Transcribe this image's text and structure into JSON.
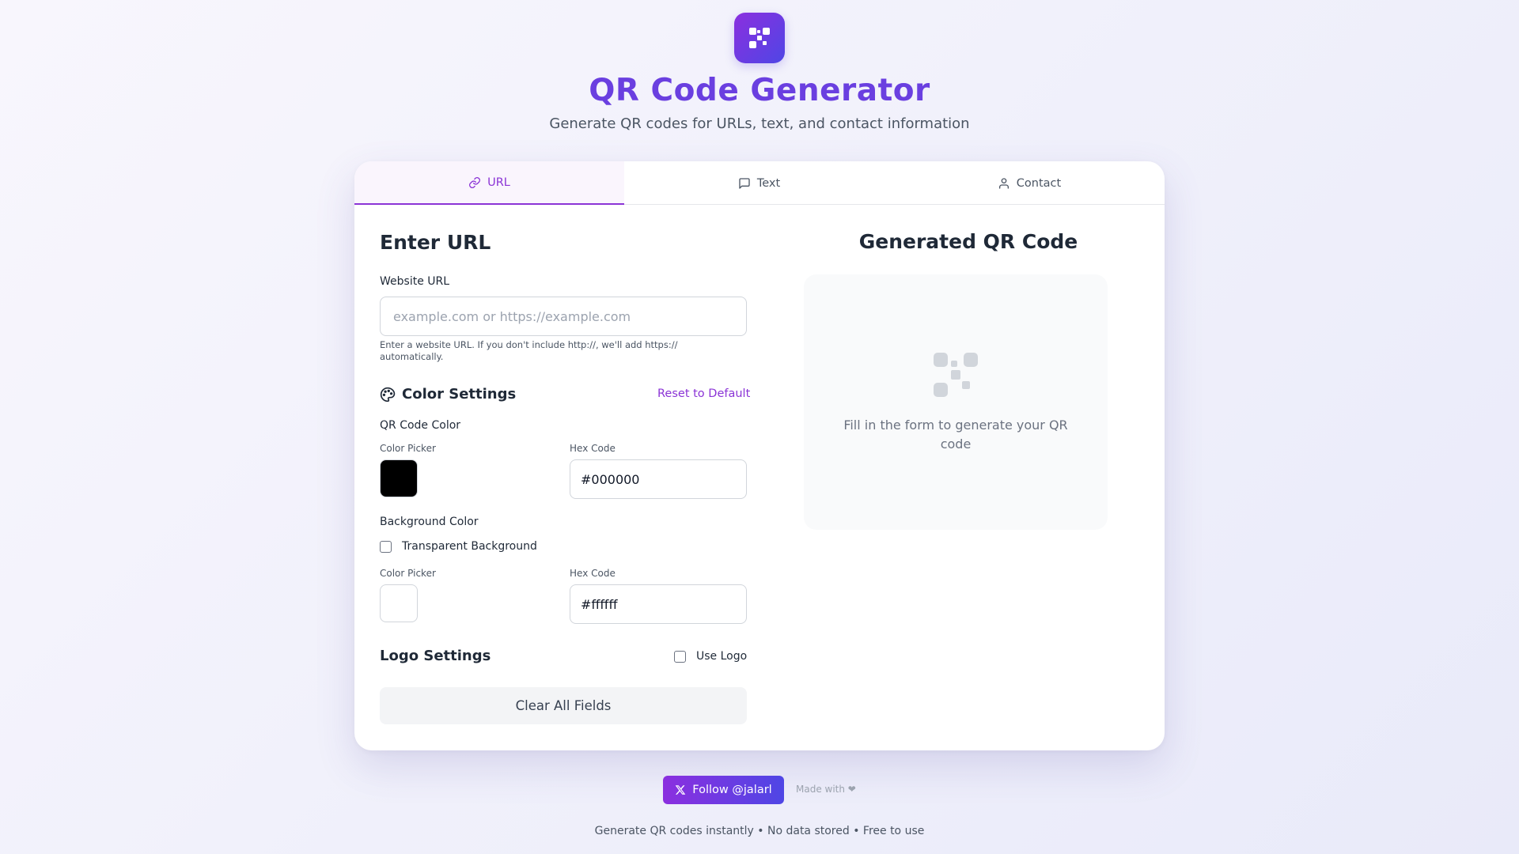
{
  "header": {
    "title": "QR Code Generator",
    "subtitle": "Generate QR codes for URLs, text, and contact information",
    "logo_icon": "qr-icon"
  },
  "tabs": [
    {
      "label": "URL",
      "icon": "link-icon",
      "active": true
    },
    {
      "label": "Text",
      "icon": "message-icon",
      "active": false
    },
    {
      "label": "Contact",
      "icon": "user-icon",
      "active": false
    }
  ],
  "form": {
    "title": "Enter URL",
    "url_label": "Website URL",
    "url_placeholder": "example.com or https://example.com",
    "url_value": "",
    "url_help": "Enter a website URL. If you don't include http://, we'll add https:// automatically."
  },
  "color_settings": {
    "title": "Color Settings",
    "icon": "palette-icon",
    "reset_label": "Reset to Default",
    "qr_color_label": "QR Code Color",
    "qr_picker_label": "Color Picker",
    "qr_hex_label": "Hex Code",
    "qr_hex_value": "#000000",
    "qr_color": "#000000",
    "bg_color_label": "Background Color",
    "transparent_label": "Transparent Background",
    "transparent_checked": false,
    "bg_picker_label": "Color Picker",
    "bg_hex_label": "Hex Code",
    "bg_hex_value": "#ffffff",
    "bg_color": "#ffffff"
  },
  "logo_settings": {
    "title": "Logo Settings",
    "use_logo_label": "Use Logo",
    "use_logo_checked": false
  },
  "clear_button": "Clear All Fields",
  "preview": {
    "title": "Generated QR Code",
    "placeholder": "Fill in the form to generate your QR code",
    "icon": "qr-icon"
  },
  "footer": {
    "follow_label": "Follow @jalarl",
    "follow_icon": "x-icon",
    "made_with": "Made with ❤",
    "tagline": "Generate QR codes instantly • No data stored • Free to use"
  },
  "colors": {
    "accent": "#8b34d6",
    "title": "#6a3fe0",
    "gradient_start": "#8b2fdf",
    "gradient_end": "#4f46e5"
  }
}
